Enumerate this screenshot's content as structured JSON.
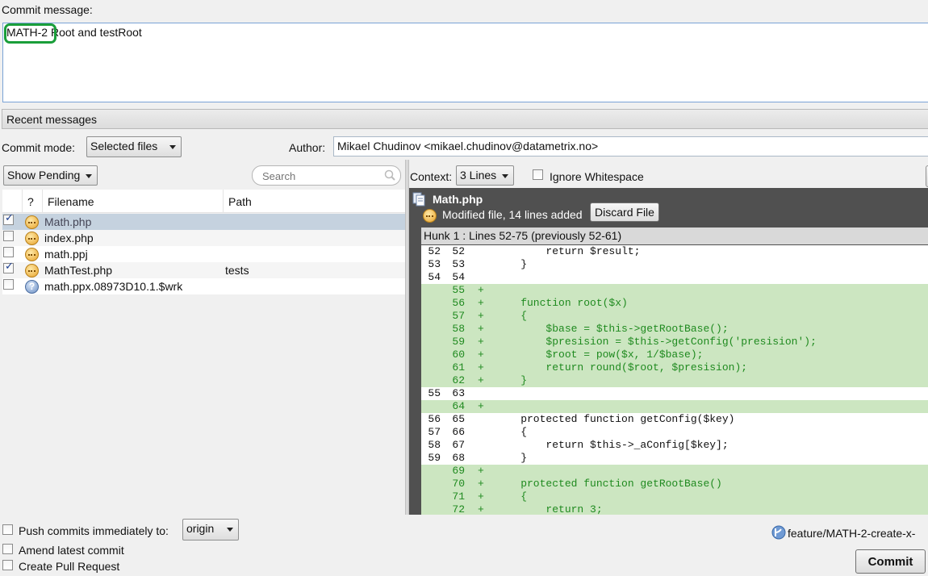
{
  "commit": {
    "message_label": "Commit message:",
    "issue_key": "MATH-2",
    "message_rest": " Root and testRoot",
    "recent_label": "Recent messages",
    "mode_label": "Commit mode:",
    "mode_value": "Selected files",
    "author_label": "Author:",
    "author_value": "Mikael Chudinov <mikael.chudinov@datametrix.no>"
  },
  "files": {
    "filter_value": "Show Pending",
    "search_placeholder": "Search",
    "col_status": "?",
    "col_filename": "Filename",
    "col_path": "Path",
    "rows": [
      {
        "checked": true,
        "status": "modified",
        "name": "Math.php",
        "path": ""
      },
      {
        "checked": false,
        "status": "modified",
        "name": "index.php",
        "path": ""
      },
      {
        "checked": false,
        "status": "modified",
        "name": "math.ppj",
        "path": ""
      },
      {
        "checked": true,
        "status": "modified",
        "name": "MathTest.php",
        "path": "tests"
      },
      {
        "checked": false,
        "status": "unknown",
        "name": "math.ppx.08973D10.1.$wrk",
        "path": ""
      }
    ]
  },
  "diff": {
    "context_label": "Context:",
    "context_value": "3 Lines",
    "ignore_ws_label": "Ignore Whitespace",
    "file_name": "Math.php",
    "file_status": "Modified file, 14 lines added",
    "discard_label": "Discard File",
    "hunk_header": "Hunk 1 : Lines 52-75 (previously 52-61)",
    "lines": [
      {
        "old": "52",
        "new": "52",
        "mark": "",
        "text": "        return $result;",
        "added": false
      },
      {
        "old": "53",
        "new": "53",
        "mark": "",
        "text": "    }",
        "added": false
      },
      {
        "old": "54",
        "new": "54",
        "mark": "",
        "text": "",
        "added": false
      },
      {
        "old": "",
        "new": "55",
        "mark": "+",
        "text": "",
        "added": true
      },
      {
        "old": "",
        "new": "56",
        "mark": "+",
        "text": "    function root($x)",
        "added": true
      },
      {
        "old": "",
        "new": "57",
        "mark": "+",
        "text": "    {",
        "added": true
      },
      {
        "old": "",
        "new": "58",
        "mark": "+",
        "text": "        $base = $this->getRootBase();",
        "added": true
      },
      {
        "old": "",
        "new": "59",
        "mark": "+",
        "text": "        $presision = $this->getConfig('presision');",
        "added": true
      },
      {
        "old": "",
        "new": "60",
        "mark": "+",
        "text": "        $root = pow($x, 1/$base);",
        "added": true
      },
      {
        "old": "",
        "new": "61",
        "mark": "+",
        "text": "        return round($root, $presision);",
        "added": true
      },
      {
        "old": "",
        "new": "62",
        "mark": "+",
        "text": "    }",
        "added": true
      },
      {
        "old": "55",
        "new": "63",
        "mark": "",
        "text": "",
        "added": false
      },
      {
        "old": "",
        "new": "64",
        "mark": "+",
        "text": "",
        "added": true
      },
      {
        "old": "56",
        "new": "65",
        "mark": "",
        "text": "    protected function getConfig($key)",
        "added": false
      },
      {
        "old": "57",
        "new": "66",
        "mark": "",
        "text": "    {",
        "added": false
      },
      {
        "old": "58",
        "new": "67",
        "mark": "",
        "text": "        return $this->_aConfig[$key];",
        "added": false
      },
      {
        "old": "59",
        "new": "68",
        "mark": "",
        "text": "    }",
        "added": false
      },
      {
        "old": "",
        "new": "69",
        "mark": "+",
        "text": "",
        "added": true
      },
      {
        "old": "",
        "new": "70",
        "mark": "+",
        "text": "    protected function getRootBase()",
        "added": true
      },
      {
        "old": "",
        "new": "71",
        "mark": "+",
        "text": "    {",
        "added": true
      },
      {
        "old": "",
        "new": "72",
        "mark": "+",
        "text": "        return 3;",
        "added": true
      }
    ]
  },
  "footer": {
    "push_label": "Push commits immediately to:",
    "push_remote": "origin",
    "amend_label": "Amend latest commit",
    "pr_label": "Create Pull Request",
    "branch": "feature/MATH-2-create-x-",
    "commit_label": "Commit"
  },
  "colors": {
    "added_bg": "#cce6c1",
    "added_text": "#1f8a1f",
    "highlight_ring": "#1a9e3a",
    "selected_row": "#c5d2df"
  }
}
